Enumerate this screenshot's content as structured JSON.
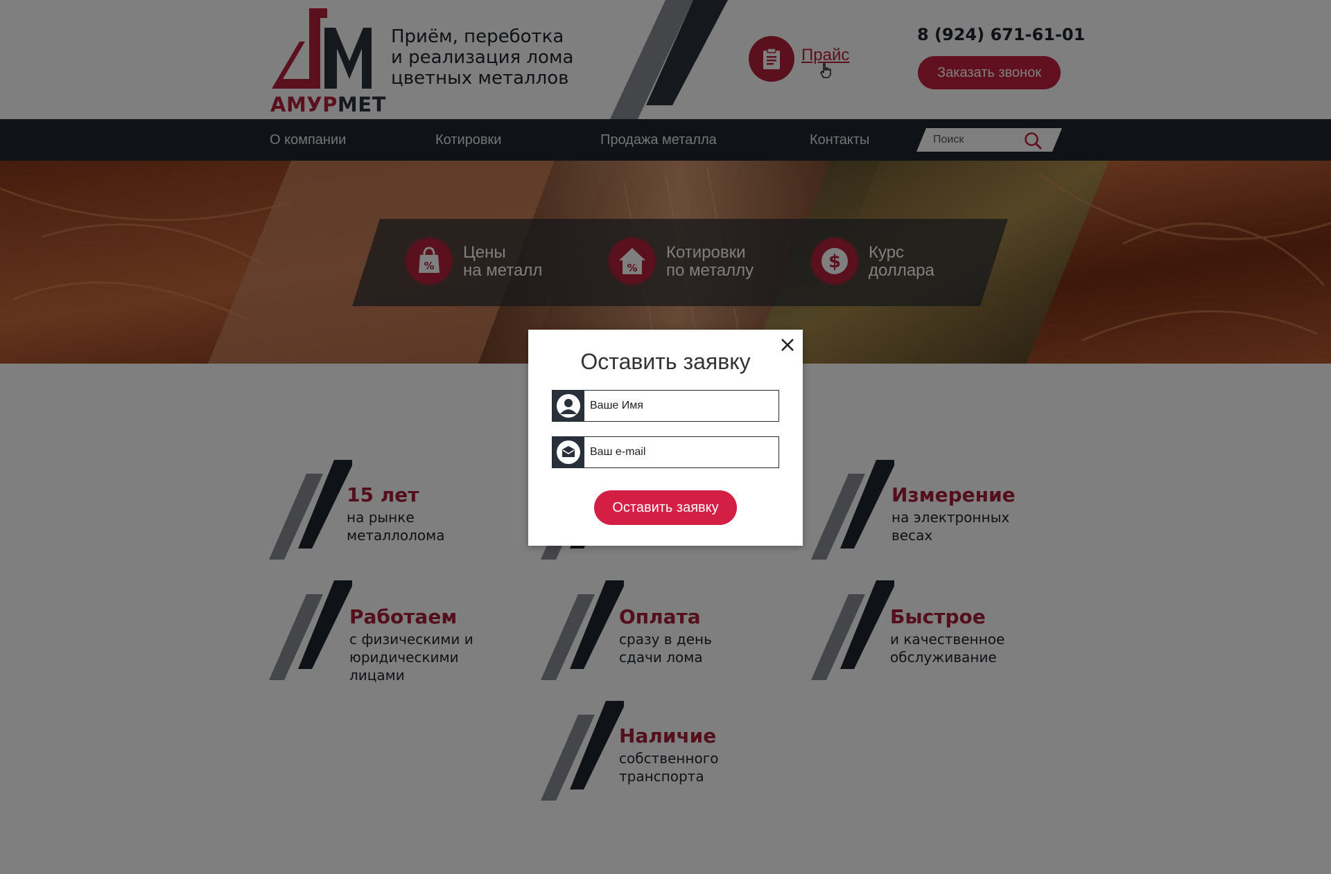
{
  "header": {
    "logo_text_accent": "АМУР",
    "logo_text_rest": "МЕТ",
    "tagline": [
      "Приём, переботка",
      "и реализация лома",
      "цветных металлов"
    ],
    "price_label": "Прайс",
    "phone": "8 (924) 671-61-01",
    "callback_label": "Заказать звонок"
  },
  "nav": {
    "items": [
      "О компании",
      "Котировки",
      "Продажа металла",
      "Контакты"
    ],
    "search_placeholder": "Поиск"
  },
  "hero": {
    "features": [
      {
        "line1": "Цены",
        "line2": "на металл",
        "icon": "bag-percent-icon"
      },
      {
        "line1": "Котировки",
        "line2": "по металлу",
        "icon": "house-percent-icon"
      },
      {
        "line1": "Курс",
        "line2": "доллара",
        "icon": "dollar-icon"
      }
    ]
  },
  "advantages": [
    {
      "title": "15 лет",
      "lines": [
        "на рынке",
        "металлолома"
      ]
    },
    {
      "title": "",
      "lines": []
    },
    {
      "title": "Измерение",
      "lines": [
        "на электронных",
        "весах"
      ]
    },
    {
      "title": "Работаем",
      "lines": [
        "с физическими и",
        "юридическими",
        "лицами"
      ]
    },
    {
      "title": "Оплата",
      "lines": [
        "сразу в день",
        "сдачи лома"
      ]
    },
    {
      "title": "Быстрое",
      "lines": [
        "и качественное",
        "обслуживание"
      ]
    },
    {
      "title": "Наличие",
      "lines": [
        "собственного",
        "транспорта"
      ]
    }
  ],
  "modal": {
    "title": "Оставить заявку",
    "name_placeholder": "Ваше Имя",
    "email_placeholder": "Ваш e-mail",
    "submit_label": "Оставить заявку"
  },
  "colors": {
    "brand_red": "#b7213d",
    "dark": "#1f252d",
    "overlay": "rgba(0,0,0,0.5)"
  }
}
